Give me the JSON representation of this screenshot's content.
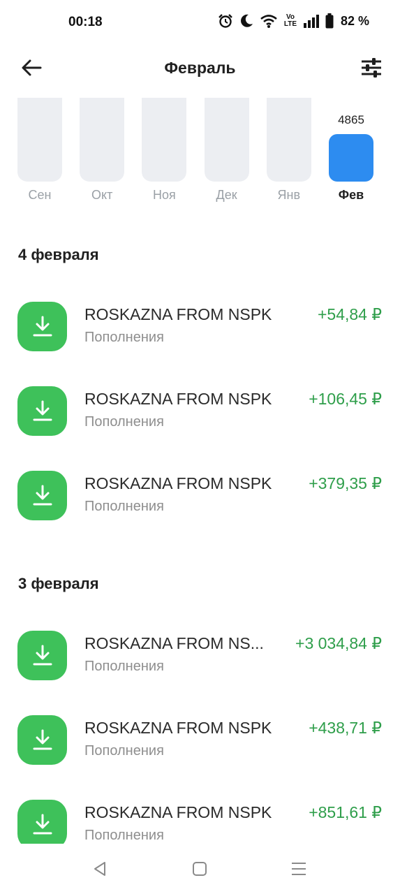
{
  "status_bar": {
    "time": "00:18",
    "network_label": "Vo LTE",
    "battery": "82 %"
  },
  "header": {
    "title": "Февраль",
    "back_icon": "arrow-left-icon",
    "filter_icon": "sliders-icon"
  },
  "chart_data": {
    "type": "bar",
    "categories": [
      "Сен",
      "Окт",
      "Ноя",
      "Дек",
      "Янв",
      "Фев"
    ],
    "values": [
      0,
      0,
      0,
      0,
      0,
      4865
    ],
    "selected": "Фев",
    "selected_value_label": "4865",
    "colors": {
      "inactive": "#eceef2",
      "active": "#2d8cf0"
    }
  },
  "sections": [
    {
      "date": "4 февраля",
      "transactions": [
        {
          "name": "ROSKAZNA FROM NSPK",
          "category": "Пополнения",
          "amount": "+54,84 ₽"
        },
        {
          "name": "ROSKAZNA FROM NSPK",
          "category": "Пополнения",
          "amount": "+106,45 ₽"
        },
        {
          "name": "ROSKAZNA FROM NSPK",
          "category": "Пополнения",
          "amount": "+379,35 ₽"
        }
      ]
    },
    {
      "date": "3 февраля",
      "transactions": [
        {
          "name": "ROSKAZNA FROM NS...",
          "category": "Пополнения",
          "amount": "+3 034,84 ₽"
        },
        {
          "name": "ROSKAZNA FROM NSPK",
          "category": "Пополнения",
          "amount": "+438,71 ₽"
        },
        {
          "name": "ROSKAZNA FROM NSPK",
          "category": "Пополнения",
          "amount": "+851,61 ₽"
        }
      ]
    }
  ],
  "colors": {
    "accent": "#2d8cf0",
    "income": "#2e9e4a",
    "icon_bg": "#3ec15a"
  },
  "transaction_icon": "download-icon",
  "nav": {
    "back": "nav-back-icon",
    "home": "nav-home-icon",
    "menu": "nav-menu-icon"
  }
}
